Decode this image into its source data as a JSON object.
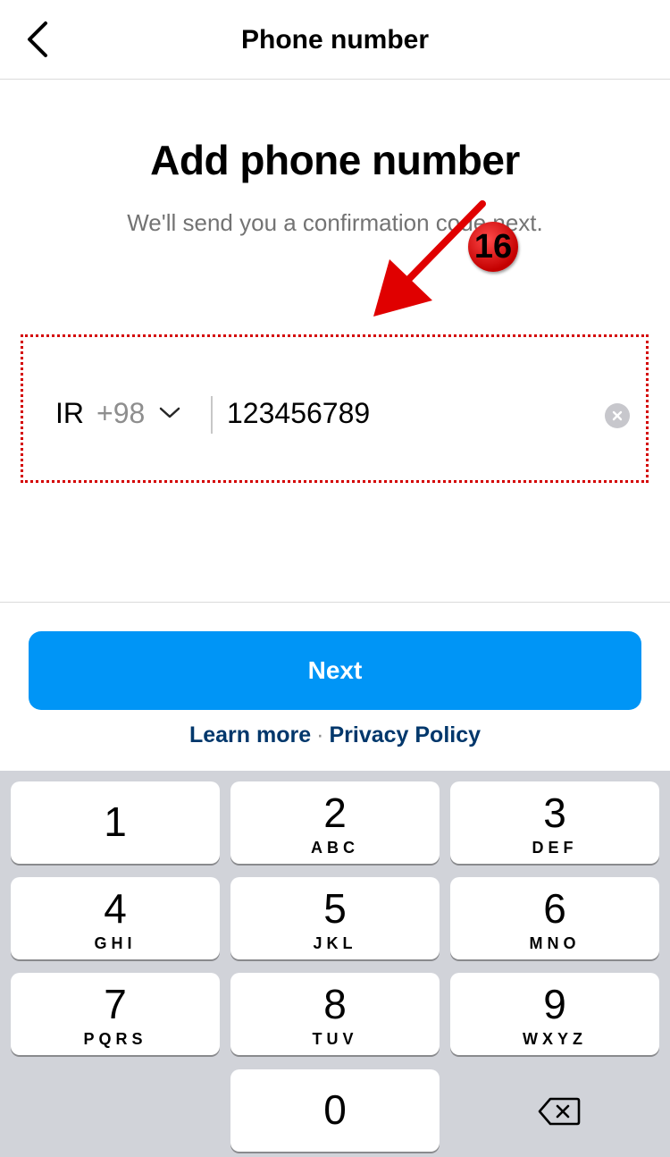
{
  "header": {
    "title": "Phone number",
    "back_icon": "chevron-left-icon"
  },
  "main": {
    "heading": "Add phone number",
    "subtitle": "We'll send you a confirmation code next."
  },
  "phone_field": {
    "country_iso": "IR",
    "dial_code": "+98",
    "dropdown_icon": "chevron-down-icon",
    "value": "123456789",
    "clear_icon": "clear-icon"
  },
  "annotation": {
    "step_number": "16",
    "color": "#d40000"
  },
  "actions": {
    "next_label": "Next",
    "learn_more": "Learn more",
    "separator": "·",
    "privacy_policy": "Privacy Policy",
    "accent_color": "#0095f6",
    "link_color": "#00376b"
  },
  "keyboard": {
    "keys": [
      {
        "digit": "1",
        "letters": ""
      },
      {
        "digit": "2",
        "letters": "ABC"
      },
      {
        "digit": "3",
        "letters": "DEF"
      },
      {
        "digit": "4",
        "letters": "GHI"
      },
      {
        "digit": "5",
        "letters": "JKL"
      },
      {
        "digit": "6",
        "letters": "MNO"
      },
      {
        "digit": "7",
        "letters": "PQRS"
      },
      {
        "digit": "8",
        "letters": "TUV"
      },
      {
        "digit": "9",
        "letters": "WXYZ"
      },
      {
        "digit": "0",
        "letters": ""
      }
    ],
    "delete_icon": "backspace-icon"
  }
}
